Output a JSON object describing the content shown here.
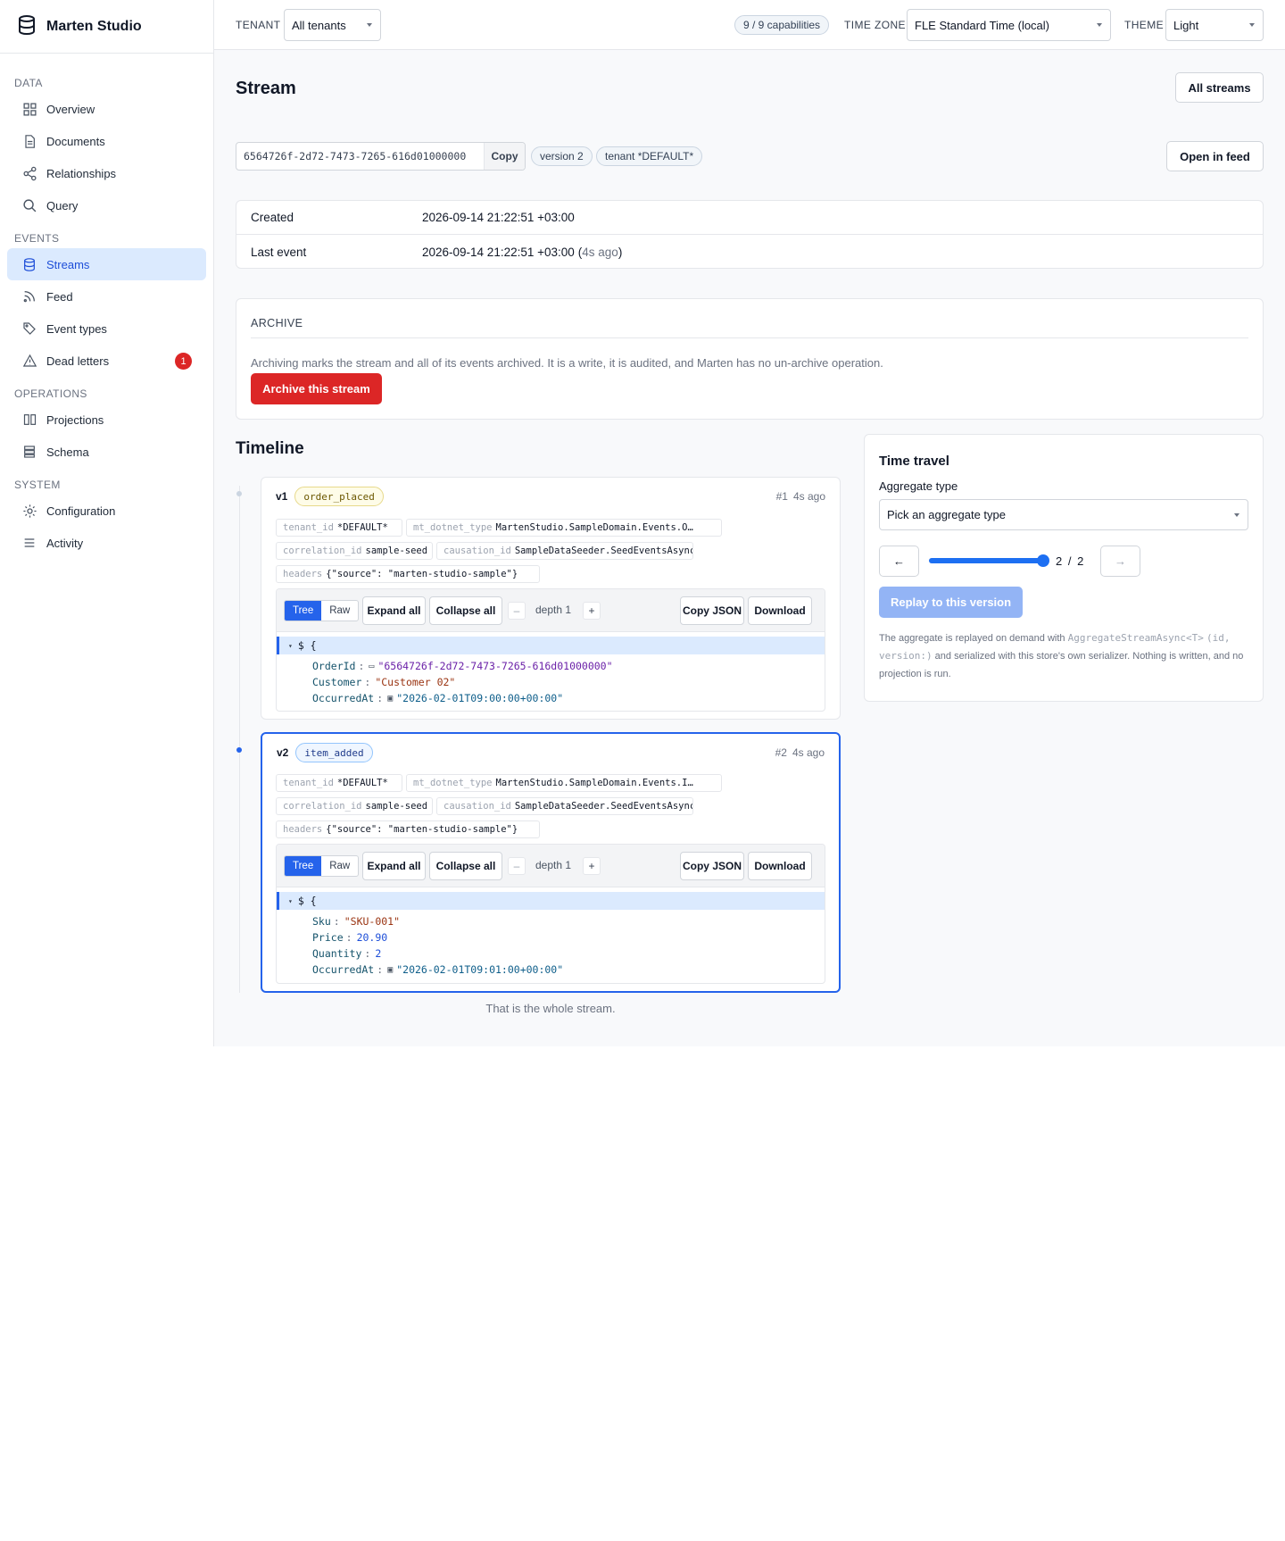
{
  "app": {
    "name": "Marten Studio"
  },
  "sidebar": {
    "sections": [
      {
        "title": "DATA",
        "items": [
          {
            "label": "Overview",
            "icon": "grid-icon"
          },
          {
            "label": "Documents",
            "icon": "document-icon"
          },
          {
            "label": "Relationships",
            "icon": "share-icon"
          },
          {
            "label": "Query",
            "icon": "search-icon"
          }
        ]
      },
      {
        "title": "EVENTS",
        "items": [
          {
            "label": "Streams",
            "icon": "database-icon",
            "active": true
          },
          {
            "label": "Feed",
            "icon": "rss-icon"
          },
          {
            "label": "Event types",
            "icon": "tag-icon"
          },
          {
            "label": "Dead letters",
            "icon": "warning-icon",
            "badge": "1"
          }
        ]
      },
      {
        "title": "OPERATIONS",
        "items": [
          {
            "label": "Projections",
            "icon": "columns-icon"
          },
          {
            "label": "Schema",
            "icon": "layers-icon"
          }
        ]
      },
      {
        "title": "SYSTEM",
        "items": [
          {
            "label": "Configuration",
            "icon": "sun-gear-icon"
          },
          {
            "label": "Activity",
            "icon": "list-icon"
          }
        ]
      }
    ]
  },
  "topbar": {
    "tenant_label": "TENANT",
    "tenant_value": "All tenants",
    "capabilities": "9 / 9 capabilities",
    "timezone_label": "TIME ZONE",
    "timezone_value": "FLE Standard Time (local)",
    "theme_label": "THEME",
    "theme_value": "Light"
  },
  "page": {
    "title": "Stream",
    "all_streams": "All streams",
    "open_in_feed": "Open in feed",
    "stream_id": "6564726f-2d72-7473-7265-616d01000000",
    "copy": "Copy",
    "version_chip": "version 2",
    "tenant_chip": "tenant *DEFAULT*",
    "created_label": "Created",
    "created_value": "2026-09-14 21:22:51 +03:00",
    "last_event_label": "Last event",
    "last_event_value": "2026-09-14 21:22:51 +03:00",
    "last_event_ago": "4s ago"
  },
  "archive": {
    "title": "ARCHIVE",
    "text": "Archiving marks the stream and all of its events archived. It is a write, it is audited, and Marten has no un-archive operation.",
    "button": "Archive this stream"
  },
  "timeline": {
    "title": "Timeline",
    "end_text": "That is the whole stream.",
    "toolbar": {
      "tree": "Tree",
      "raw": "Raw",
      "expand": "Expand all",
      "collapse": "Collapse all",
      "minus": "–",
      "depth": "depth 1",
      "plus": "+",
      "copy_json": "Copy JSON",
      "download": "Download"
    },
    "events": [
      {
        "version": "v1",
        "type": "order_placed",
        "seq": "#1",
        "ago": "4s ago",
        "tenant_k": "tenant_id",
        "tenant_v": "*DEFAULT*",
        "dotnet_k": "mt_dotnet_type",
        "dotnet_v": "MartenStudio.SampleDomain.Events.O…",
        "corr_k": "correlation_id",
        "corr_v": "sample-seed",
        "caus_k": "causation_id",
        "caus_v": "SampleDataSeeder.SeedEventsAsync",
        "headers_k": "headers",
        "headers_v": "{\"source\": \"marten-studio-sample\"}",
        "root": "$ {",
        "fields": [
          {
            "key": "OrderId",
            "value": "\"6564726f-2d72-7473-7265-616d01000000\"",
            "kind": "id"
          },
          {
            "key": "Customer",
            "value": "\"Customer 02\"",
            "kind": "str"
          },
          {
            "key": "OccurredAt",
            "value": "\"2026-02-01T09:00:00+00:00\"",
            "kind": "date"
          }
        ]
      },
      {
        "version": "v2",
        "type": "item_added",
        "seq": "#2",
        "ago": "4s ago",
        "tenant_k": "tenant_id",
        "tenant_v": "*DEFAULT*",
        "dotnet_k": "mt_dotnet_type",
        "dotnet_v": "MartenStudio.SampleDomain.Events.I…",
        "corr_k": "correlation_id",
        "corr_v": "sample-seed",
        "caus_k": "causation_id",
        "caus_v": "SampleDataSeeder.SeedEventsAsync",
        "headers_k": "headers",
        "headers_v": "{\"source\": \"marten-studio-sample\"}",
        "root": "$ {",
        "fields": [
          {
            "key": "Sku",
            "value": "\"SKU-001\"",
            "kind": "str"
          },
          {
            "key": "Price",
            "value": "20.90",
            "kind": "num"
          },
          {
            "key": "Quantity",
            "value": "2",
            "kind": "num"
          },
          {
            "key": "OccurredAt",
            "value": "\"2026-02-01T09:01:00+00:00\"",
            "kind": "date"
          }
        ]
      }
    ]
  },
  "time_travel": {
    "title": "Time travel",
    "aggregate_label": "Aggregate type",
    "aggregate_placeholder": "Pick an aggregate type",
    "prev": "←",
    "next": "→",
    "position": "2 / 2",
    "slider_fraction": 1.0,
    "replay": "Replay to this version",
    "note_1": "The aggregate is replayed on demand with ",
    "note_code_1": "AggregateStreamAsync<T>",
    "note_code_2": "(id, version:)",
    "note_2": " and serialized with this store's own serializer. Nothing is written, and no projection is run."
  },
  "colors": {
    "accent": "#2563eb",
    "danger": "#dc2626",
    "active_bg": "#dbeafe"
  }
}
